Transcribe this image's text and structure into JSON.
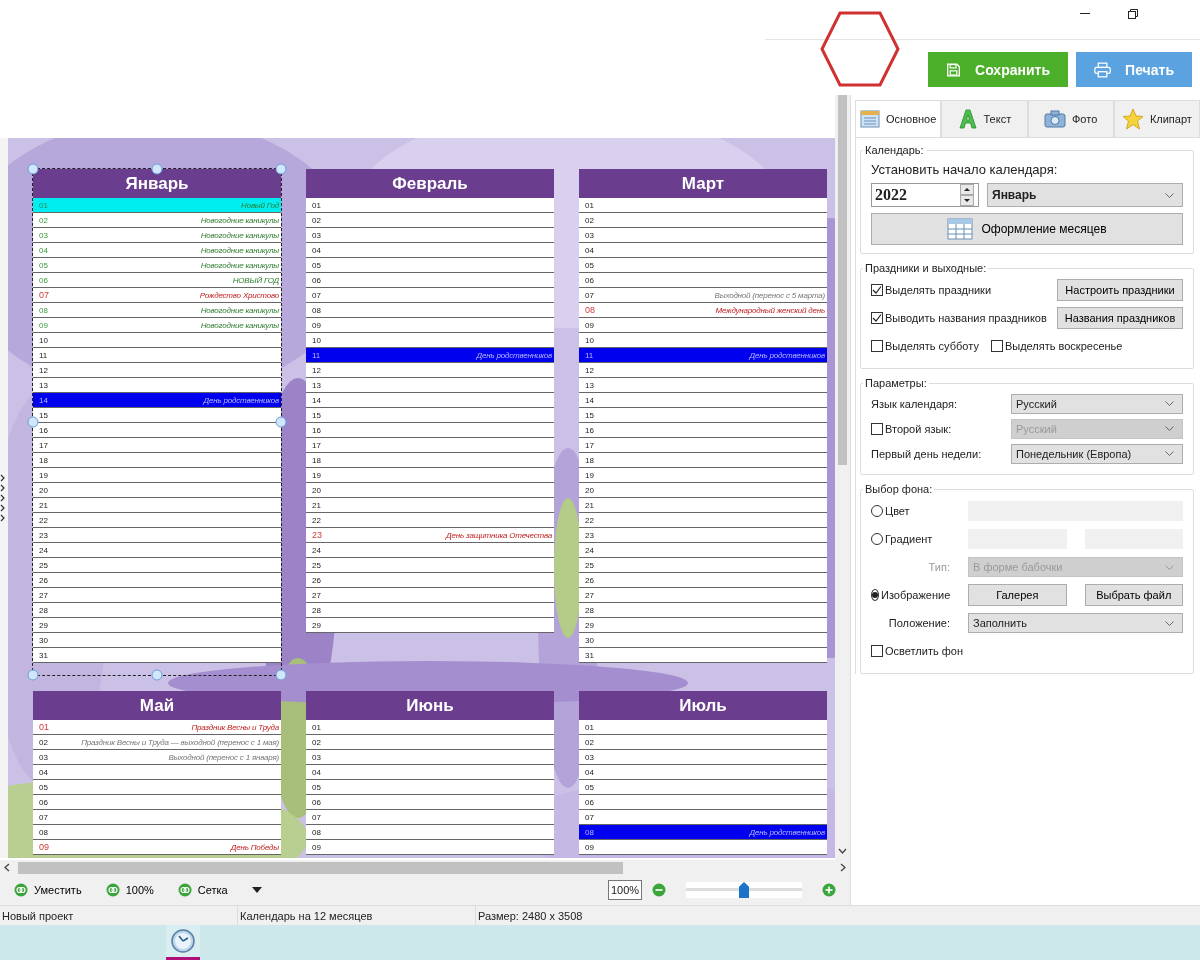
{
  "actions": {
    "save": "Сохранить",
    "print": "Печать"
  },
  "months": [
    {
      "name": "Январь",
      "selected": true,
      "rows": [
        {
          "day": "01",
          "kind": "today",
          "note": "Новый Год"
        },
        {
          "day": "02",
          "kind": "vacation",
          "note": "Новогодние каникулы"
        },
        {
          "day": "03",
          "kind": "vacation",
          "note": "Новогодние каникулы"
        },
        {
          "day": "04",
          "kind": "vacation",
          "note": "Новогодние каникулы"
        },
        {
          "day": "05",
          "kind": "vacation",
          "note": "Новогодние каникулы"
        },
        {
          "day": "06",
          "kind": "vacation",
          "note": "НОВЫЙ ГОД"
        },
        {
          "day": "07",
          "kind": "holiday",
          "note": "Рождество Христово"
        },
        {
          "day": "08",
          "kind": "vacation",
          "note": "Новогодние каникулы"
        },
        {
          "day": "09",
          "kind": "vacation",
          "note": "Новогодние каникулы"
        },
        {
          "day": "10",
          "kind": "plain"
        },
        {
          "day": "11",
          "kind": "plain"
        },
        {
          "day": "12",
          "kind": "plain"
        },
        {
          "day": "13",
          "kind": "plain"
        },
        {
          "day": "14",
          "kind": "marked",
          "note": "День родственников"
        },
        {
          "day": "15",
          "kind": "plain"
        },
        {
          "day": "16",
          "kind": "plain"
        },
        {
          "day": "17",
          "kind": "plain"
        },
        {
          "day": "18",
          "kind": "plain"
        },
        {
          "day": "19",
          "kind": "plain"
        },
        {
          "day": "20",
          "kind": "plain"
        },
        {
          "day": "21",
          "kind": "plain"
        },
        {
          "day": "22",
          "kind": "plain"
        },
        {
          "day": "23",
          "kind": "plain"
        },
        {
          "day": "24",
          "kind": "plain"
        },
        {
          "day": "25",
          "kind": "plain"
        },
        {
          "day": "26",
          "kind": "plain"
        },
        {
          "day": "27",
          "kind": "plain"
        },
        {
          "day": "28",
          "kind": "plain"
        },
        {
          "day": "29",
          "kind": "plain"
        },
        {
          "day": "30",
          "kind": "plain"
        },
        {
          "day": "31",
          "kind": "plain"
        }
      ]
    },
    {
      "name": "Февраль",
      "selected": false,
      "rows": [
        {
          "day": "01",
          "kind": "plain"
        },
        {
          "day": "02",
          "kind": "plain"
        },
        {
          "day": "03",
          "kind": "plain"
        },
        {
          "day": "04",
          "kind": "plain"
        },
        {
          "day": "05",
          "kind": "plain"
        },
        {
          "day": "06",
          "kind": "plain"
        },
        {
          "day": "07",
          "kind": "plain"
        },
        {
          "day": "08",
          "kind": "plain"
        },
        {
          "day": "09",
          "kind": "plain"
        },
        {
          "day": "10",
          "kind": "plain"
        },
        {
          "day": "11",
          "kind": "marked",
          "note": "День родственников"
        },
        {
          "day": "12",
          "kind": "plain"
        },
        {
          "day": "13",
          "kind": "plain"
        },
        {
          "day": "14",
          "kind": "plain"
        },
        {
          "day": "15",
          "kind": "plain"
        },
        {
          "day": "16",
          "kind": "plain"
        },
        {
          "day": "17",
          "kind": "plain"
        },
        {
          "day": "18",
          "kind": "plain"
        },
        {
          "day": "19",
          "kind": "plain"
        },
        {
          "day": "20",
          "kind": "plain"
        },
        {
          "day": "21",
          "kind": "plain"
        },
        {
          "day": "22",
          "kind": "plain"
        },
        {
          "day": "23",
          "kind": "holiday",
          "note": "День защитника Отечества"
        },
        {
          "day": "24",
          "kind": "plain"
        },
        {
          "day": "25",
          "kind": "plain"
        },
        {
          "day": "26",
          "kind": "plain"
        },
        {
          "day": "27",
          "kind": "plain"
        },
        {
          "day": "28",
          "kind": "plain"
        },
        {
          "day": "29",
          "kind": "plain"
        }
      ]
    },
    {
      "name": "Март",
      "selected": false,
      "rows": [
        {
          "day": "01",
          "kind": "plain"
        },
        {
          "day": "02",
          "kind": "plain"
        },
        {
          "day": "03",
          "kind": "plain"
        },
        {
          "day": "04",
          "kind": "plain"
        },
        {
          "day": "05",
          "kind": "plain"
        },
        {
          "day": "06",
          "kind": "plain"
        },
        {
          "day": "07",
          "kind": "note",
          "note": "Выходной (перенос с 5 марта)"
        },
        {
          "day": "08",
          "kind": "holiday",
          "note": "Международный женский день"
        },
        {
          "day": "09",
          "kind": "plain"
        },
        {
          "day": "10",
          "kind": "plain"
        },
        {
          "day": "11",
          "kind": "marked",
          "note": "День родственников"
        },
        {
          "day": "12",
          "kind": "plain"
        },
        {
          "day": "13",
          "kind": "plain"
        },
        {
          "day": "14",
          "kind": "plain"
        },
        {
          "day": "15",
          "kind": "plain"
        },
        {
          "day": "16",
          "kind": "plain"
        },
        {
          "day": "17",
          "kind": "plain"
        },
        {
          "day": "18",
          "kind": "plain"
        },
        {
          "day": "19",
          "kind": "plain"
        },
        {
          "day": "20",
          "kind": "plain"
        },
        {
          "day": "21",
          "kind": "plain"
        },
        {
          "day": "22",
          "kind": "plain"
        },
        {
          "day": "23",
          "kind": "plain"
        },
        {
          "day": "24",
          "kind": "plain"
        },
        {
          "day": "25",
          "kind": "plain"
        },
        {
          "day": "26",
          "kind": "plain"
        },
        {
          "day": "27",
          "kind": "plain"
        },
        {
          "day": "28",
          "kind": "plain"
        },
        {
          "day": "29",
          "kind": "plain"
        },
        {
          "day": "30",
          "kind": "plain"
        },
        {
          "day": "31",
          "kind": "plain"
        }
      ]
    },
    {
      "name": "Май",
      "selected": false,
      "rows": [
        {
          "day": "01",
          "kind": "holiday",
          "note": "Праздник Весны и Труда"
        },
        {
          "day": "02",
          "kind": "note",
          "note": "Праздник Весны и Труда — выходной (перенос с 1 мая)"
        },
        {
          "day": "03",
          "kind": "note",
          "note": "Выходной (перенос с 1 января)"
        },
        {
          "day": "04",
          "kind": "plain"
        },
        {
          "day": "05",
          "kind": "plain"
        },
        {
          "day": "06",
          "kind": "plain"
        },
        {
          "day": "07",
          "kind": "plain"
        },
        {
          "day": "08",
          "kind": "plain"
        },
        {
          "day": "09",
          "kind": "holiday",
          "note": "День Победы"
        }
      ]
    },
    {
      "name": "Июнь",
      "selected": false,
      "rows": [
        {
          "day": "01",
          "kind": "plain"
        },
        {
          "day": "02",
          "kind": "plain"
        },
        {
          "day": "03",
          "kind": "plain"
        },
        {
          "day": "04",
          "kind": "plain"
        },
        {
          "day": "05",
          "kind": "plain"
        },
        {
          "day": "06",
          "kind": "plain"
        },
        {
          "day": "07",
          "kind": "plain"
        },
        {
          "day": "08",
          "kind": "plain"
        },
        {
          "day": "09",
          "kind": "plain"
        }
      ]
    },
    {
      "name": "Июль",
      "selected": false,
      "rows": [
        {
          "day": "01",
          "kind": "plain"
        },
        {
          "day": "02",
          "kind": "plain"
        },
        {
          "day": "03",
          "kind": "plain"
        },
        {
          "day": "04",
          "kind": "plain"
        },
        {
          "day": "05",
          "kind": "plain"
        },
        {
          "day": "06",
          "kind": "plain"
        },
        {
          "day": "07",
          "kind": "plain"
        },
        {
          "day": "08",
          "kind": "marked",
          "note": "День родственников"
        },
        {
          "day": "09",
          "kind": "plain"
        }
      ]
    }
  ],
  "view_toolbar": {
    "buttons": [
      "Уместить",
      "100%",
      "Сетка"
    ],
    "zoom": "100%",
    "zoom_slider": {
      "level": 0.5
    }
  },
  "tabs": [
    {
      "label": "Основное",
      "selected": true
    },
    {
      "label": "Текст",
      "selected": false
    },
    {
      "label": "Фото",
      "selected": false
    },
    {
      "label": "Клипарт",
      "selected": false
    }
  ],
  "calendar_group": {
    "title": "Календарь:",
    "label": "Установить начало календаря:",
    "year": "2022",
    "month": "Январь",
    "design_button": "Оформление месяцев"
  },
  "holidays_group": {
    "title": "Праздники и выходные:",
    "options": [
      {
        "label": "Выделять праздники",
        "checked": true,
        "button": "Настроить праздники"
      },
      {
        "label": "Выводить названия праздников",
        "checked": true,
        "button": "Названия праздников"
      }
    ],
    "weekend_options": [
      {
        "label": "Выделять субботу",
        "checked": false
      },
      {
        "label": "Выделять воскресенье",
        "checked": false
      }
    ]
  },
  "params_group": {
    "title": "Параметры:",
    "rows": [
      {
        "kind": "select",
        "label": "Язык календаря:",
        "value": "Русский",
        "disabled": false
      },
      {
        "kind": "checkbox",
        "label": "Второй язык:",
        "checked": false,
        "value": "Русский",
        "disabled": true
      },
      {
        "kind": "select",
        "label": "Первый день недели:",
        "value": "Понедельник (Европа)",
        "disabled": false
      }
    ]
  },
  "background_group": {
    "title": "Выбор фона:",
    "options": [
      {
        "kind": "color",
        "label": "Цвет",
        "selected": false
      },
      {
        "kind": "gradient",
        "label": "Градиент",
        "selected": false
      },
      {
        "label": "Изображение",
        "selected": true,
        "buttons": [
          "Галерея",
          "Выбрать файл"
        ]
      }
    ],
    "type": {
      "label": "Тип:",
      "value": "В форме бабочки",
      "disabled": true
    },
    "position": {
      "label": "Положение:",
      "value": "Заполнить"
    },
    "lighten": {
      "label": "Осветлить фон",
      "checked": false
    }
  },
  "status_bar": [
    "Новый проект",
    "Календарь на 12 месяцев",
    "Размер: 2480 x 3508"
  ]
}
